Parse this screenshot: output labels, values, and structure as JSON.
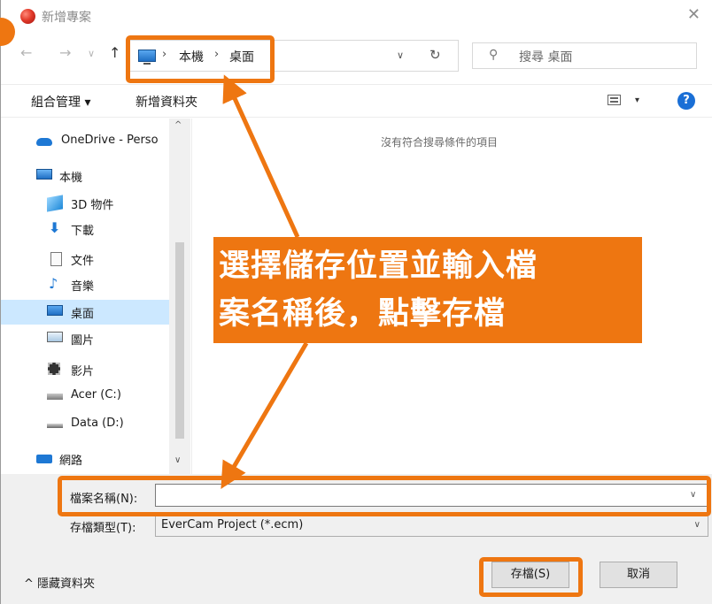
{
  "window": {
    "title": "新增專案",
    "close_glyph": "✕"
  },
  "nav": {
    "back_glyph": "←",
    "forward_glyph": "→",
    "recent_glyph": "∨",
    "up_glyph": "↑",
    "breadcrumb": [
      "本機",
      "桌面"
    ],
    "breadcrumb_sep": "›",
    "dropdown_glyph": "∨",
    "refresh_glyph": "↻",
    "search_placeholder": "搜尋 桌面",
    "search_glyph": "⚲"
  },
  "toolbar": {
    "organize_label": "組合管理 ▾",
    "new_folder_label": "新增資料夾",
    "view_drop_glyph": "▾",
    "help_label": "?"
  },
  "sidebar": {
    "scroll_up": "^",
    "scroll_down": "∨",
    "items": [
      {
        "label": "OneDrive - Perso",
        "icon": "cloud-icon"
      },
      {
        "label": "本機",
        "icon": "pc-icon"
      },
      {
        "label": "3D 物件",
        "icon": "cube-icon"
      },
      {
        "label": "下載",
        "icon": "download-icon",
        "glyph": "⬇"
      },
      {
        "label": "文件",
        "icon": "document-icon"
      },
      {
        "label": "音樂",
        "icon": "music-icon",
        "glyph": "♪"
      },
      {
        "label": "桌面",
        "icon": "desktop-icon"
      },
      {
        "label": "圖片",
        "icon": "pictures-icon"
      },
      {
        "label": "影片",
        "icon": "videos-icon"
      },
      {
        "label": "Acer (C:)",
        "icon": "drive-icon"
      },
      {
        "label": "Data (D:)",
        "icon": "drive-icon"
      },
      {
        "label": "網路",
        "icon": "network-icon"
      }
    ],
    "selected_index": 6
  },
  "main": {
    "empty_message": "沒有符合搜尋條件的項目"
  },
  "form": {
    "filename_label": "檔案名稱(N):",
    "filename_value": "",
    "filetype_label": "存檔類型(T):",
    "filetype_value": "EverCam Project (*.ecm)",
    "dropdown_glyph": "∨",
    "hide_folders_label": "^  隱藏資料夾",
    "save_label": "存檔(S)",
    "cancel_label": "取消"
  },
  "annotation": {
    "lines": [
      "選擇儲存位置並輸入檔",
      "案名稱後，點擊存檔"
    ],
    "color": "#ee7611"
  }
}
